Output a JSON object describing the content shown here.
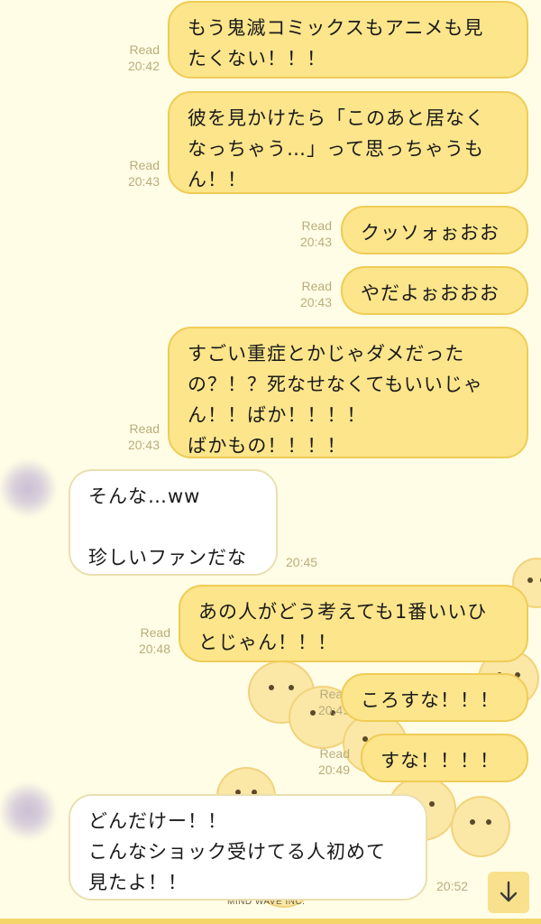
{
  "messages": [
    {
      "side": "out",
      "text": "もう鬼滅コミックスもアニメも見\nたくない！！！",
      "read": "Read",
      "time": "20:42"
    },
    {
      "side": "out",
      "text": "彼を見かけたら「このあと居なく\nなっちゃう…」って思っちゃうも\nん！！",
      "read": "Read",
      "time": "20:43"
    },
    {
      "side": "out",
      "text": "クッソォぉおお",
      "read": "Read",
      "time": "20:43"
    },
    {
      "side": "out",
      "text": "やだよぉおおお",
      "read": "Read",
      "time": "20:43"
    },
    {
      "side": "out",
      "text": "すごい重症とかじゃダメだった\nの？！？死なせなくてもいいじゃ\nん！！ばか！！！！\nばかもの！！！！",
      "read": "Read",
      "time": "20:43"
    },
    {
      "side": "in",
      "text": "そんな…ww\n\n珍しいファンだな",
      "time": "20:45"
    },
    {
      "side": "out",
      "text": "あの人がどう考えても1番いいひ\nとじゃん！！！",
      "read": "Read",
      "time": "20:48"
    },
    {
      "side": "out",
      "text": "ころすな！！！",
      "read": "Read",
      "time": "20:49"
    },
    {
      "side": "out",
      "text": "すな！！！！",
      "read": "Read",
      "time": "20:49"
    },
    {
      "side": "in",
      "text": "どんだけー！！\nこんなショック受けてる人初めて\n見たよ！！",
      "time": "20:52"
    }
  ],
  "sticker_brand": "MIND WAVE INC.",
  "colors": {
    "background": "#fffde6",
    "outgoing_bubble": "#fce58b",
    "incoming_bubble": "#ffffff",
    "meta_text": "#b9ad7c"
  },
  "icons": {
    "scroll_down": "arrow-down-icon"
  }
}
